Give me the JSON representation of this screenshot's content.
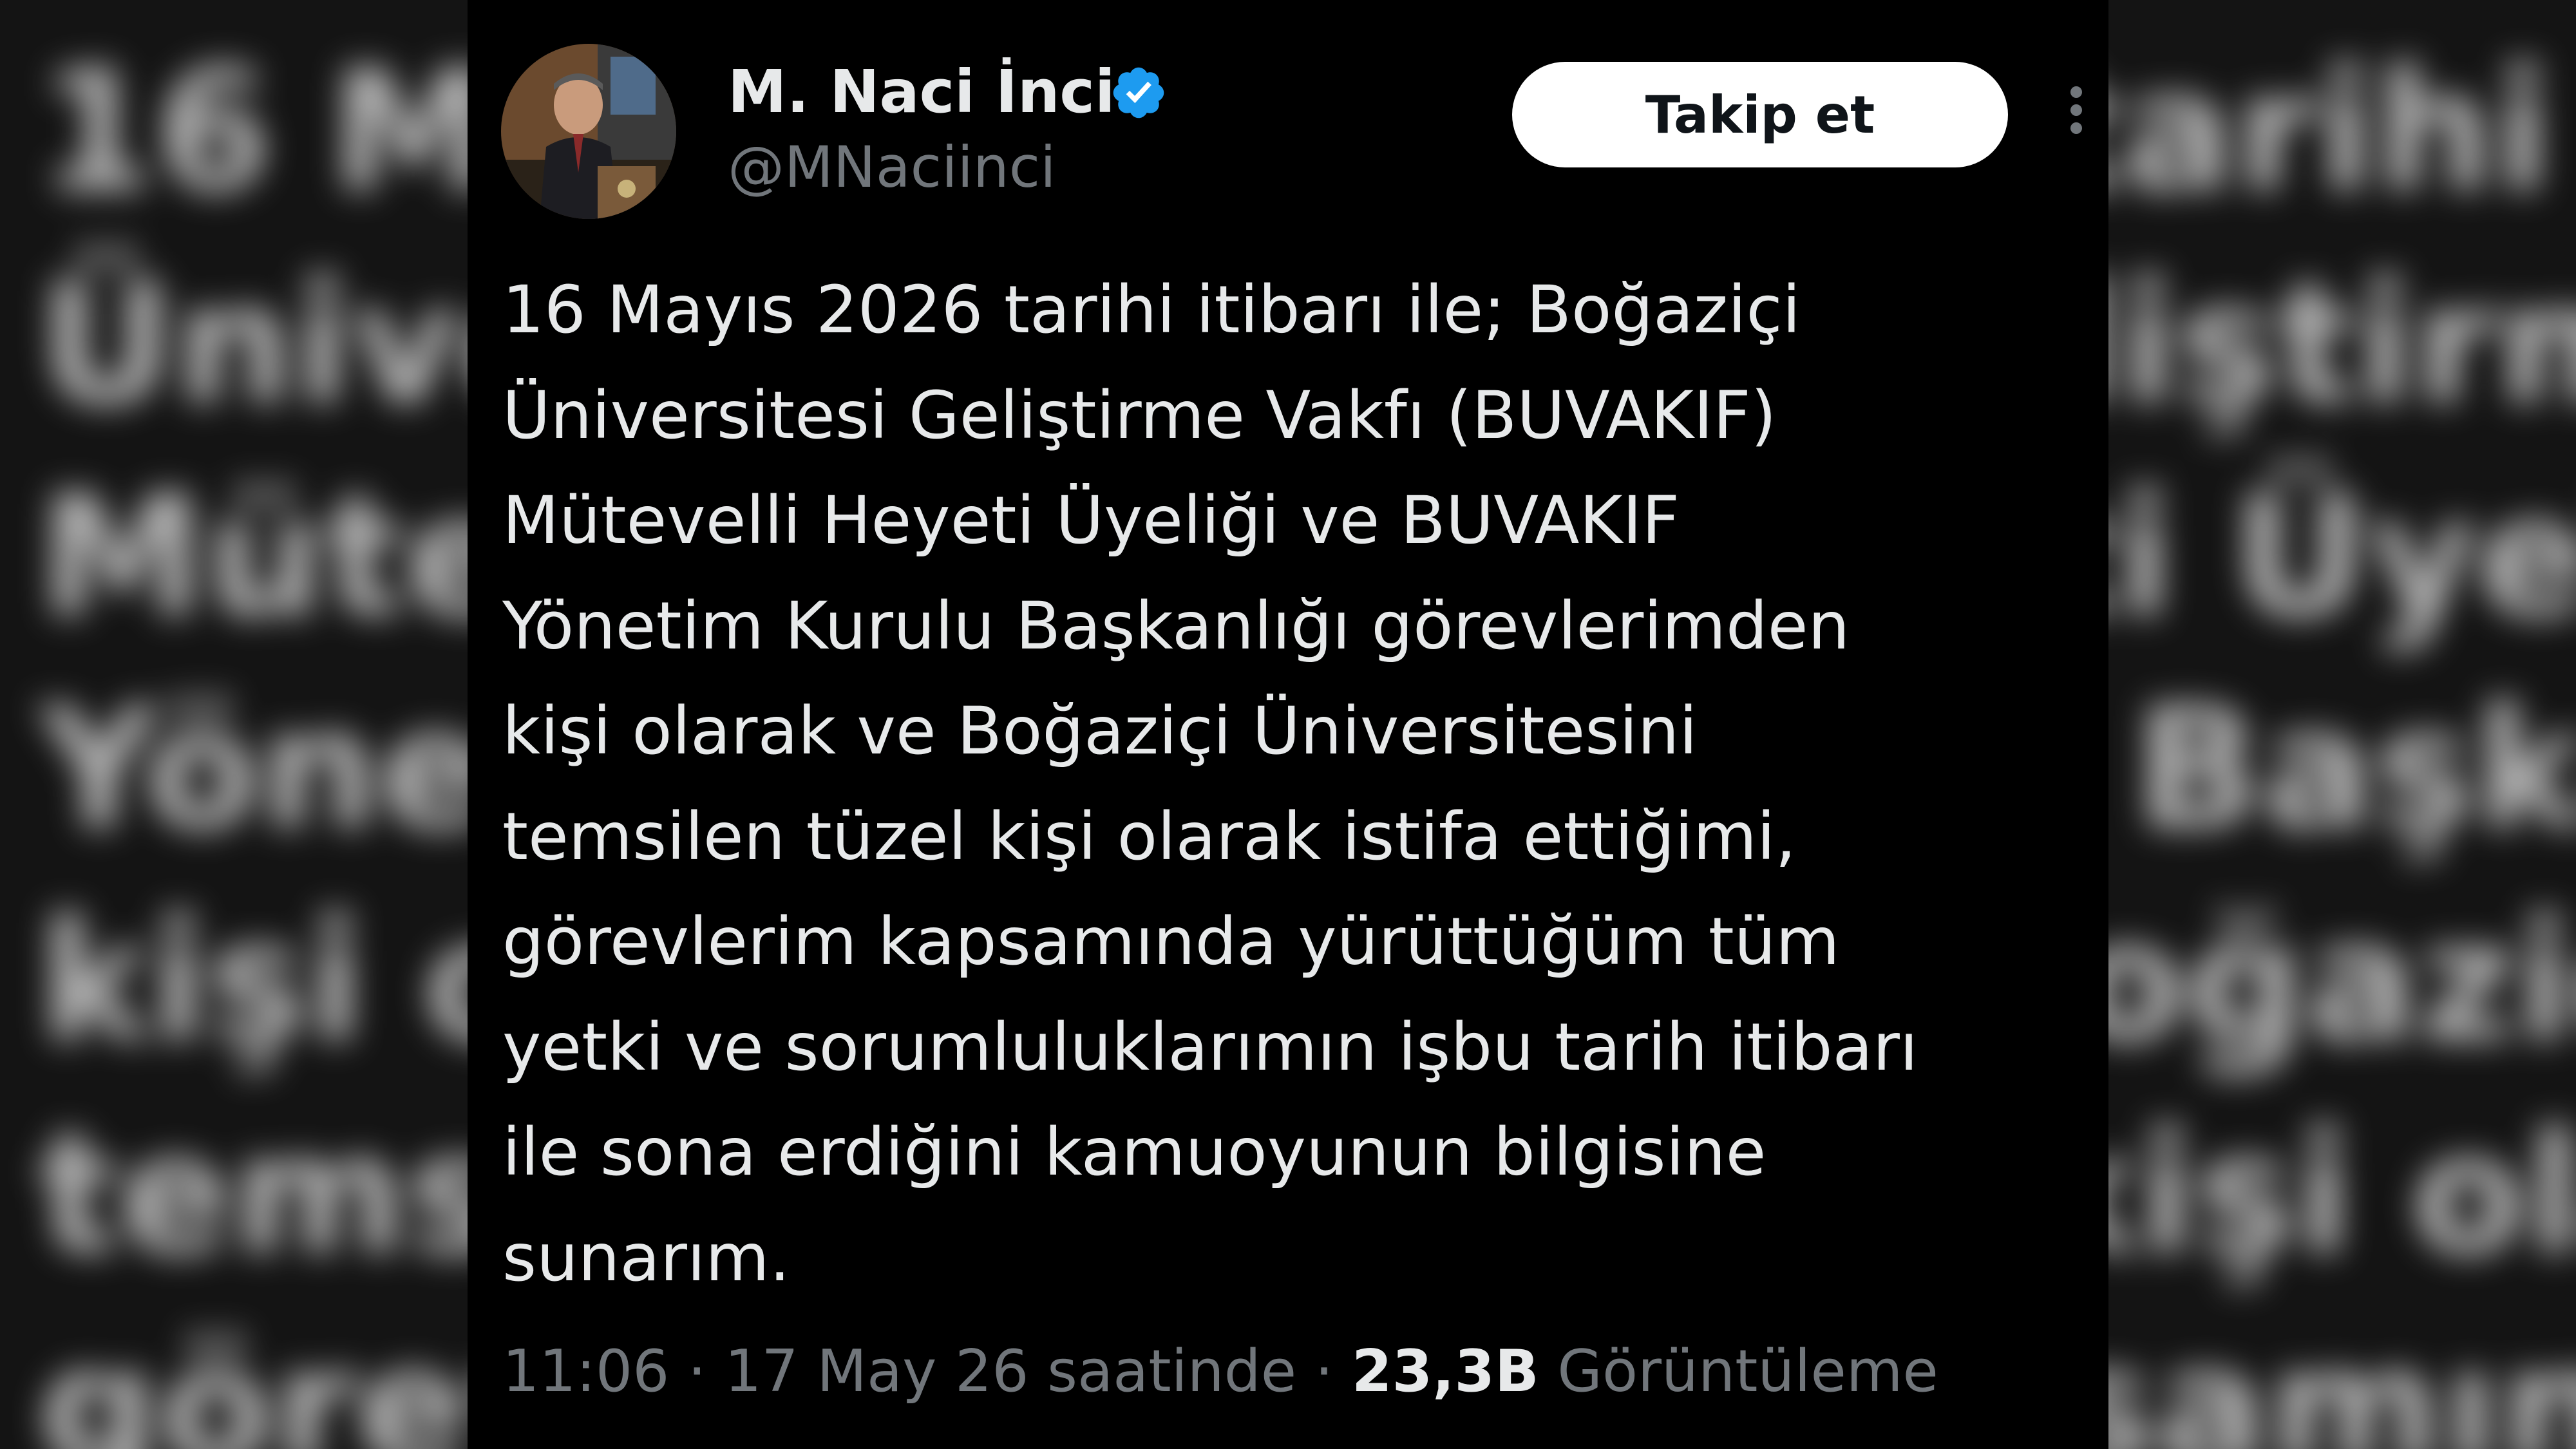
{
  "author": {
    "display_name": "M. Naci İnci",
    "handle": "@MNaciinci",
    "verified_icon": "verified-badge-icon",
    "avatar_icon": "avatar"
  },
  "actions": {
    "follow_label": "Takip et",
    "more_icon": "more-options-icon"
  },
  "tweet": {
    "lines": [
      "16 Mayıs 2026 tarihi itibarı ile; Boğaziçi",
      "Üniversitesi Geliştirme Vakfı (BUVAKIF)",
      "Mütevelli Heyeti Üyeliği ve BUVAKIF",
      "Yönetim Kurulu Başkanlığı görevlerimden",
      "kişi olarak ve Boğaziçi Üniversitesini",
      "temsilen tüzel kişi olarak istifa ettiğimi,",
      "görevlerim kapsamında yürüttüğüm tüm",
      "yetki ve sorumluluklarımın işbu tarih itibarı",
      "ile sona erdiğini kamuoyunun bilgisine",
      "sunarım."
    ]
  },
  "meta": {
    "time_date": "11:06 · 17 May 26 saatinde ·",
    "views_count": "23,3B",
    "views_label": "Görüntüleme"
  },
  "colors": {
    "background": "#000000",
    "text_primary": "#e7e9ea",
    "text_secondary": "#71767b",
    "verified_blue": "#1d9bf0",
    "follow_button_bg": "#ffffff"
  }
}
